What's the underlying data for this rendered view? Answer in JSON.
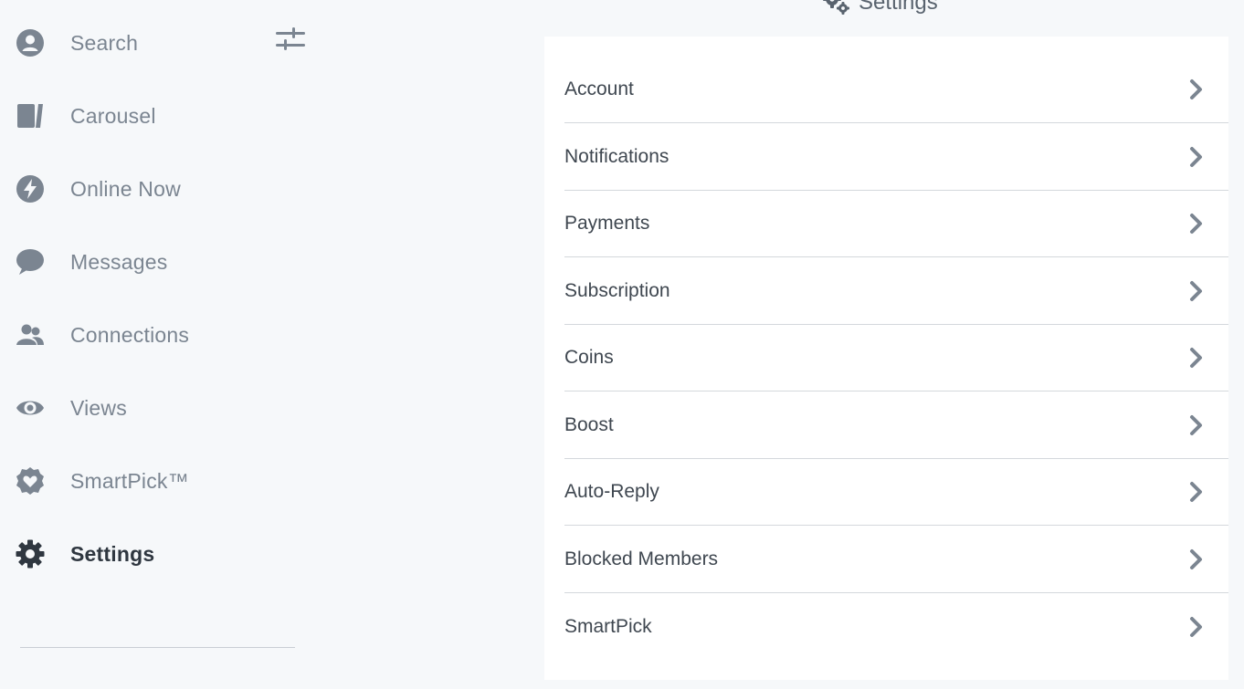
{
  "sidebar": {
    "items": [
      {
        "label": "Search",
        "icon": "user-circle-icon",
        "active": false
      },
      {
        "label": "Carousel",
        "icon": "cards-icon",
        "active": false
      },
      {
        "label": "Online Now",
        "icon": "lightning-icon",
        "active": false
      },
      {
        "label": "Messages",
        "icon": "chat-bubble-icon",
        "active": false
      },
      {
        "label": "Connections",
        "icon": "people-icon",
        "active": false
      },
      {
        "label": "Views",
        "icon": "eye-icon",
        "active": false
      },
      {
        "label": "SmartPick™",
        "icon": "heart-badge-icon",
        "active": false
      },
      {
        "label": "Settings",
        "icon": "gear-icon",
        "active": true
      }
    ],
    "filter_icon": "sliders-icon"
  },
  "main": {
    "heading": "Settings",
    "heading_icon": "gears-icon",
    "menu": [
      {
        "label": "Account"
      },
      {
        "label": "Notifications"
      },
      {
        "label": "Payments"
      },
      {
        "label": "Subscription"
      },
      {
        "label": "Coins"
      },
      {
        "label": "Boost"
      },
      {
        "label": "Auto-Reply"
      },
      {
        "label": "Blocked Members"
      },
      {
        "label": "SmartPick"
      }
    ]
  },
  "colors": {
    "background": "#f6f8fa",
    "panel": "#ffffff",
    "icon_inactive": "#7b8591",
    "icon_active": "#2f3740",
    "text": "#3f4750",
    "divider": "#d4d8dc"
  }
}
